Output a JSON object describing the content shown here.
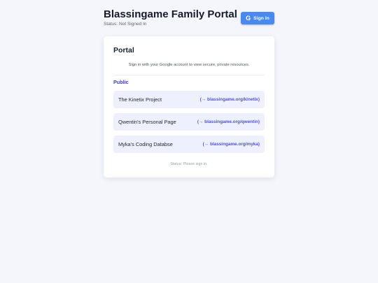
{
  "header": {
    "title": "Blassingame Family Portal",
    "status": "Status: Not Signed In",
    "signin_label": "Sign In",
    "signin_icon": "google-g-icon",
    "accent_color": "#4a8af0"
  },
  "card": {
    "title": "Portal",
    "description": "Sign in with your Google account to view secure, private resources.",
    "section_label": "Public",
    "links": [
      {
        "name": "The Kinetix Project",
        "url": "(→ blassingame.org/kinetix)"
      },
      {
        "name": "Qwentin's Personal Page",
        "url": "(→ blassingame.org/qwentin)"
      },
      {
        "name": "Myka's Coding Databse",
        "url": "(→ blassingame.org/myka)"
      }
    ],
    "footer_status": "Status: Please sign in."
  }
}
